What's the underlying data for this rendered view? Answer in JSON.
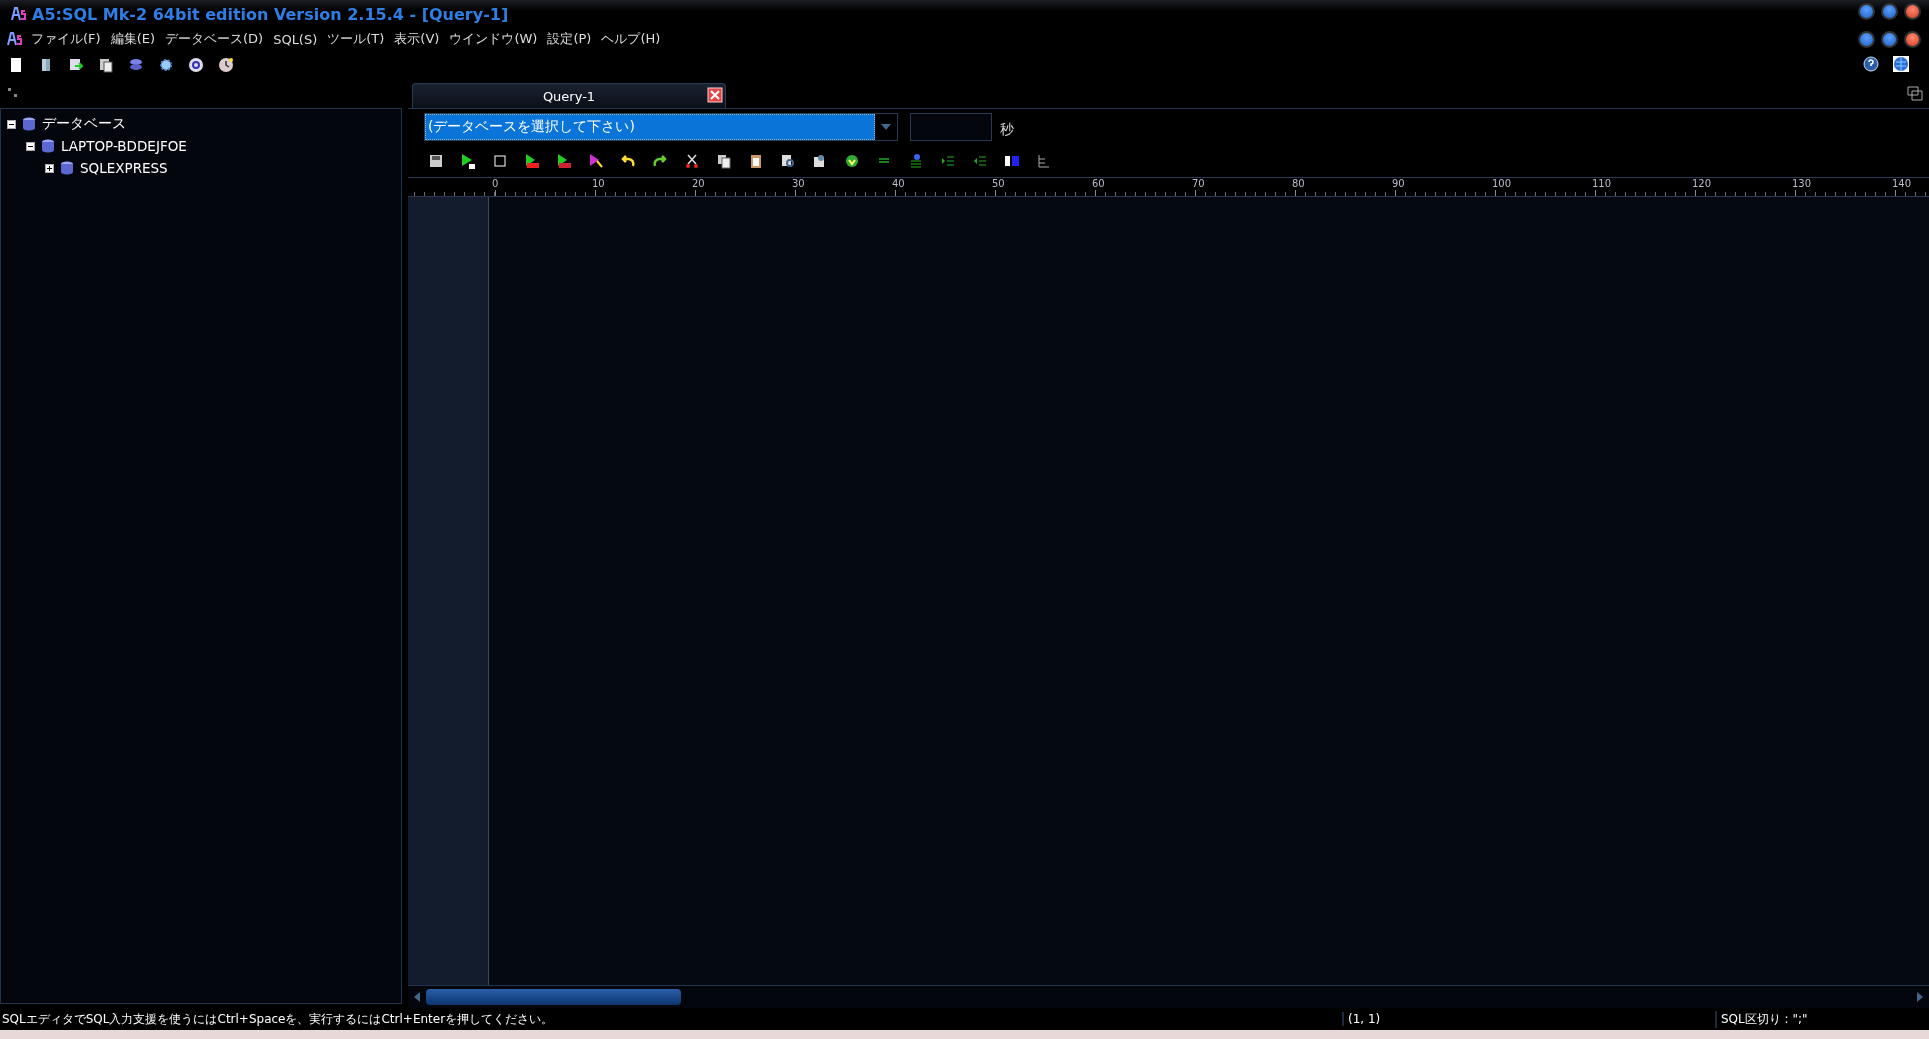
{
  "window": {
    "title": "A5:SQL Mk-2 64bit edition Version 2.15.4 - [Query-1]"
  },
  "menu": [
    "ファイル(F)",
    "編集(E)",
    "データベース(D)",
    "SQL(S)",
    "ツール(T)",
    "表示(V)",
    "ウインドウ(W)",
    "設定(P)",
    "ヘルプ(H)"
  ],
  "tree": [
    {
      "label": "データベース",
      "expanded": true,
      "children": [
        {
          "label": "LAPTOP-BDDEJFOE",
          "expanded": true,
          "children": [
            {
              "label": "SQLEXPRESS",
              "expanded": false
            }
          ]
        }
      ]
    }
  ],
  "tabs": [
    {
      "label": "Query-1",
      "selected": true
    }
  ],
  "database_select": {
    "value": "(データベースを選択して下さい)"
  },
  "timer": {
    "unit": "秒"
  },
  "ruler": [
    "0",
    "10",
    "20",
    "30",
    "40",
    "50",
    "60",
    "70",
    "80",
    "90",
    "100",
    "110",
    "120",
    "130",
    "140"
  ],
  "status_bar": {
    "message": "SQLエディタでSQL入力支援を使うにはCtrl+Spaceを、実行するにはCtrl+Enterを押してください。",
    "position": "(1, 1)",
    "delimiter": "SQL区切り : \";\""
  }
}
